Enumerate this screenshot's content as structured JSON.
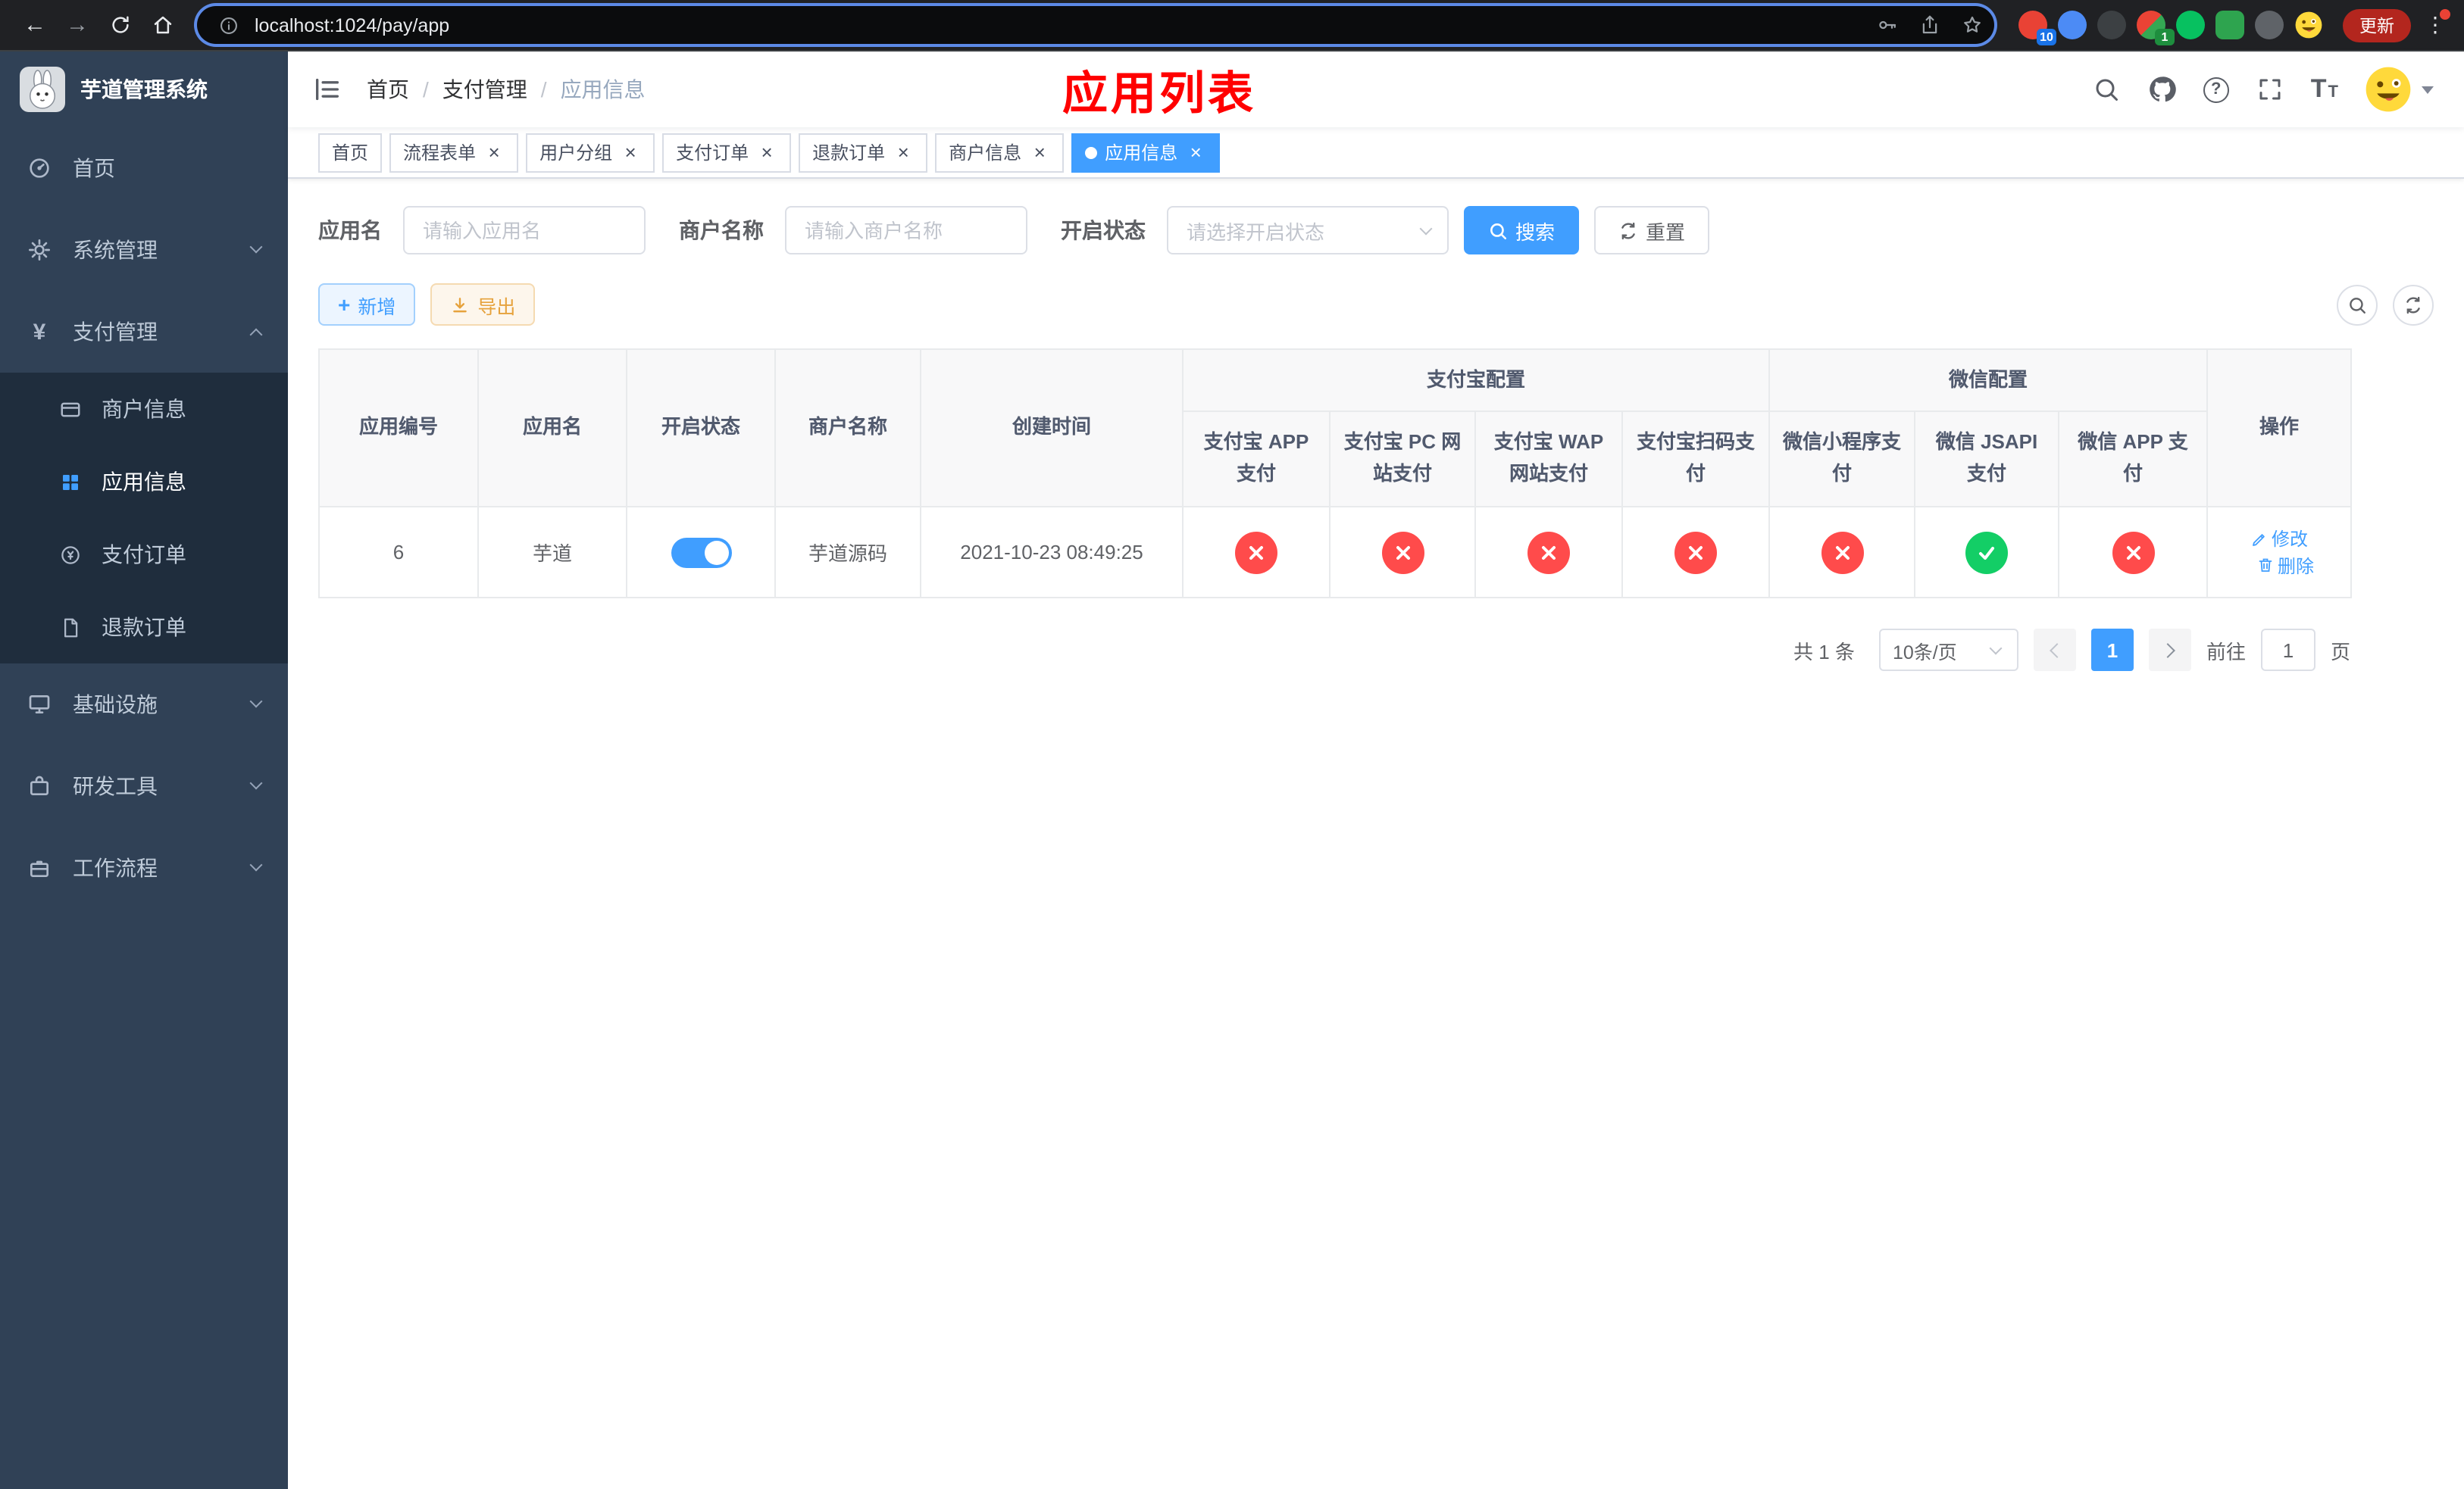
{
  "browser": {
    "url": "localhost:1024/pay/app",
    "update_label": "更新",
    "extension_badges": {
      "first": "10",
      "second": "1"
    }
  },
  "icons": {
    "back": "←",
    "forward": "→",
    "dots": "⋮",
    "yen": "¥",
    "close": "×",
    "plus": "+",
    "question": "?",
    "size_large": "T",
    "size_small": "T"
  },
  "sidebar": {
    "logo_title": "芋道管理系统",
    "items": [
      {
        "label": "首页"
      },
      {
        "label": "系统管理"
      },
      {
        "label": "支付管理"
      },
      {
        "label": "基础设施"
      },
      {
        "label": "研发工具"
      },
      {
        "label": "工作流程"
      }
    ],
    "payment_submenu": [
      {
        "label": "商户信息"
      },
      {
        "label": "应用信息"
      },
      {
        "label": "支付订单"
      },
      {
        "label": "退款订单"
      }
    ]
  },
  "header": {
    "breadcrumb": [
      {
        "label": "首页"
      },
      {
        "label": "支付管理"
      },
      {
        "label": "应用信息"
      }
    ],
    "breadcrumb_separator": "/",
    "page_title": "应用列表"
  },
  "tabs": [
    {
      "label": "首页"
    },
    {
      "label": "流程表单"
    },
    {
      "label": "用户分组"
    },
    {
      "label": "支付订单"
    },
    {
      "label": "退款订单"
    },
    {
      "label": "商户信息"
    },
    {
      "label": "应用信息"
    }
  ],
  "filters": {
    "app_name": {
      "label": "应用名",
      "placeholder": "请输入应用名",
      "value": ""
    },
    "merchant_name": {
      "label": "商户名称",
      "placeholder": "请输入商户名称",
      "value": ""
    },
    "status": {
      "label": "开启状态",
      "placeholder": "请选择开启状态",
      "value": ""
    },
    "search_label": "搜索",
    "reset_label": "重置"
  },
  "toolbar": {
    "add_label": "新增",
    "export_label": "导出"
  },
  "table": {
    "group_alipay": "支付宝配置",
    "group_wechat": "微信配置",
    "columns": [
      "应用编号",
      "应用名",
      "开启状态",
      "商户名称",
      "创建时间",
      "支付宝 APP 支付",
      "支付宝 PC 网站支付",
      "支付宝 WAP 网站支付",
      "支付宝扫码支付",
      "微信小程序支付",
      "微信 JSAPI 支付",
      "微信 APP 支付",
      "操作"
    ],
    "row": {
      "app_id": "6",
      "app_name": "芋道",
      "status_enabled": true,
      "merchant_name": "芋道源码",
      "created_at": "2021-10-23 08:49:25",
      "configs": [
        false,
        false,
        false,
        false,
        false,
        true,
        false
      ],
      "edit_label": "修改",
      "delete_label": "删除"
    }
  },
  "pagination": {
    "total_text": "共 1 条",
    "page_size": "10条/页",
    "current_page": "1",
    "goto_label": "前往",
    "goto_value": "1",
    "unit_label": "页"
  },
  "colors": {
    "accent": "#409eff",
    "success": "#13ce66",
    "danger": "#ff4b4b",
    "warning": "#e6a23c",
    "title_red": "#ff0000",
    "sidebar_bg": "#304156",
    "submenu_bg": "#1f2d3d"
  }
}
